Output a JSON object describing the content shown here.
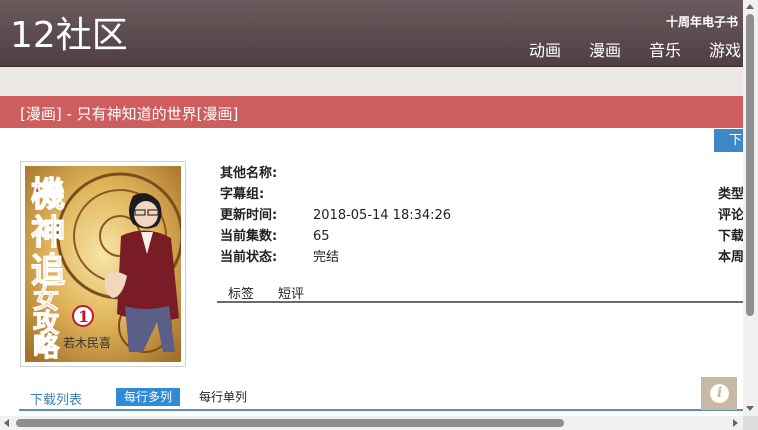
{
  "site": {
    "logo": "12社区",
    "anniversary": "十周年电子书",
    "nav": [
      "动画",
      "漫画",
      "音乐",
      "游戏"
    ]
  },
  "page": {
    "title": "[漫画] - 只有神知道的世界[漫画]",
    "download_button": "下"
  },
  "cover": {
    "title_text": "機神追女攻略",
    "volume": "1",
    "author": "若木民喜"
  },
  "info": {
    "other_names_label": "其他名称:",
    "other_names_value": "",
    "subtitle_group_label": "字幕组:",
    "subtitle_group_value": "",
    "updated_label": "更新时间:",
    "updated_value": "2018-05-14 18:34:26",
    "episodes_label": "当前集数:",
    "episodes_value": "65",
    "status_label": "当前状态:",
    "status_value": "完结"
  },
  "right_col": [
    "类型",
    "评论",
    "下载",
    "本周"
  ],
  "tabs": [
    "标签",
    "短评"
  ],
  "download_list": {
    "label": "下载列表",
    "multi": "每行多列",
    "single": "每行单列"
  },
  "info_icon": "i",
  "colors": {
    "header": "#5e4c4f",
    "title_bar": "#cf5d5d",
    "accent_blue": "#2f8bd8"
  }
}
